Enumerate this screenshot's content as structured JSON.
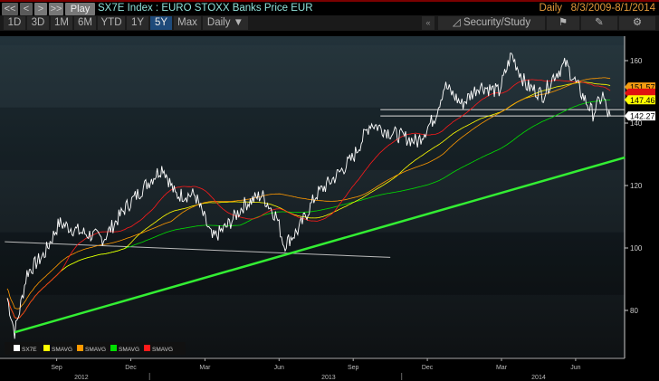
{
  "toolbar": {
    "nav": [
      "<<",
      "<",
      ">",
      ">>"
    ],
    "play": "Play",
    "title": "SX7E Index : EURO STOXX Banks Price EUR",
    "frequency_label": "Daily",
    "date_range": "8/3/2009-8/1/2014",
    "periods": [
      "1D",
      "3D",
      "1M",
      "6M",
      "YTD",
      "1Y",
      "5Y",
      "Max"
    ],
    "selected_period": "5Y",
    "frequency_select": "Daily ▼",
    "collapse": "«",
    "security_study": "Security/Study"
  },
  "colors": {
    "price": "#ffffff",
    "sma1": "#ffff00",
    "sma2": "#ff9900",
    "sma3": "#00e000",
    "sma4": "#ff1a1a",
    "trend": "#33ee33"
  },
  "chart_data": {
    "type": "line",
    "ylim": [
      68,
      170
    ],
    "yticks": [
      80,
      100,
      120,
      140,
      160
    ],
    "xticks": [
      {
        "t": 2,
        "label": "Sep"
      },
      {
        "t": 5,
        "label": "Dec"
      },
      {
        "t": 8,
        "label": "Mar"
      },
      {
        "t": 11,
        "label": "Jun"
      },
      {
        "t": 14,
        "label": "Sep"
      },
      {
        "t": 17,
        "label": "Dec"
      },
      {
        "t": 20,
        "label": "Mar"
      },
      {
        "t": 23,
        "label": "Jun"
      }
    ],
    "years": [
      {
        "t": 3,
        "label": "2012"
      },
      {
        "t": 13,
        "label": "2013"
      },
      {
        "t": 21.5,
        "label": "2014"
      }
    ],
    "x_unit": "months since Jul 2012",
    "xlim": [
      -0.1,
      25
    ],
    "price": [
      [
        0,
        84
      ],
      [
        0.3,
        73
      ],
      [
        0.5,
        80
      ],
      [
        0.8,
        92
      ],
      [
        1.5,
        98
      ],
      [
        2.1,
        108
      ],
      [
        3,
        105
      ],
      [
        3.9,
        103
      ],
      [
        4.8,
        113
      ],
      [
        5.7,
        121
      ],
      [
        6.3,
        126
      ],
      [
        6.8,
        117
      ],
      [
        7.6,
        117
      ],
      [
        8.3,
        103
      ],
      [
        8.9,
        107
      ],
      [
        9.6,
        114
      ],
      [
        10.3,
        117
      ],
      [
        10.9,
        110
      ],
      [
        11.2,
        101
      ],
      [
        11.8,
        106
      ],
      [
        12.5,
        117
      ],
      [
        13.3,
        123
      ],
      [
        14,
        129
      ],
      [
        14.7,
        140
      ],
      [
        15.5,
        137
      ],
      [
        16.6,
        134
      ],
      [
        17.3,
        142
      ],
      [
        17.7,
        152
      ],
      [
        18.4,
        146
      ],
      [
        19.1,
        152
      ],
      [
        19.9,
        150
      ],
      [
        20.4,
        162
      ],
      [
        21,
        152
      ],
      [
        21.7,
        149
      ],
      [
        22.1,
        155
      ],
      [
        22.6,
        159
      ],
      [
        23.2,
        150
      ],
      [
        23.7,
        143
      ],
      [
        24.1,
        149
      ],
      [
        24.3,
        143
      ],
      [
        24.4,
        142.27
      ]
    ],
    "legend": [
      "SX7E",
      "SMAVG",
      "SMAVG",
      "SMAVG",
      "SMAVG"
    ],
    "last_values": {
      "sma_orange": "151.57",
      "price": "142.27",
      "sma_yellow": "147.46"
    },
    "trendline": [
      [
        0.3,
        73
      ],
      [
        25,
        129
      ]
    ],
    "support_line": [
      [
        -0.1,
        102
      ],
      [
        15.5,
        97
      ]
    ],
    "channel": [
      142.3,
      144.3
    ]
  }
}
